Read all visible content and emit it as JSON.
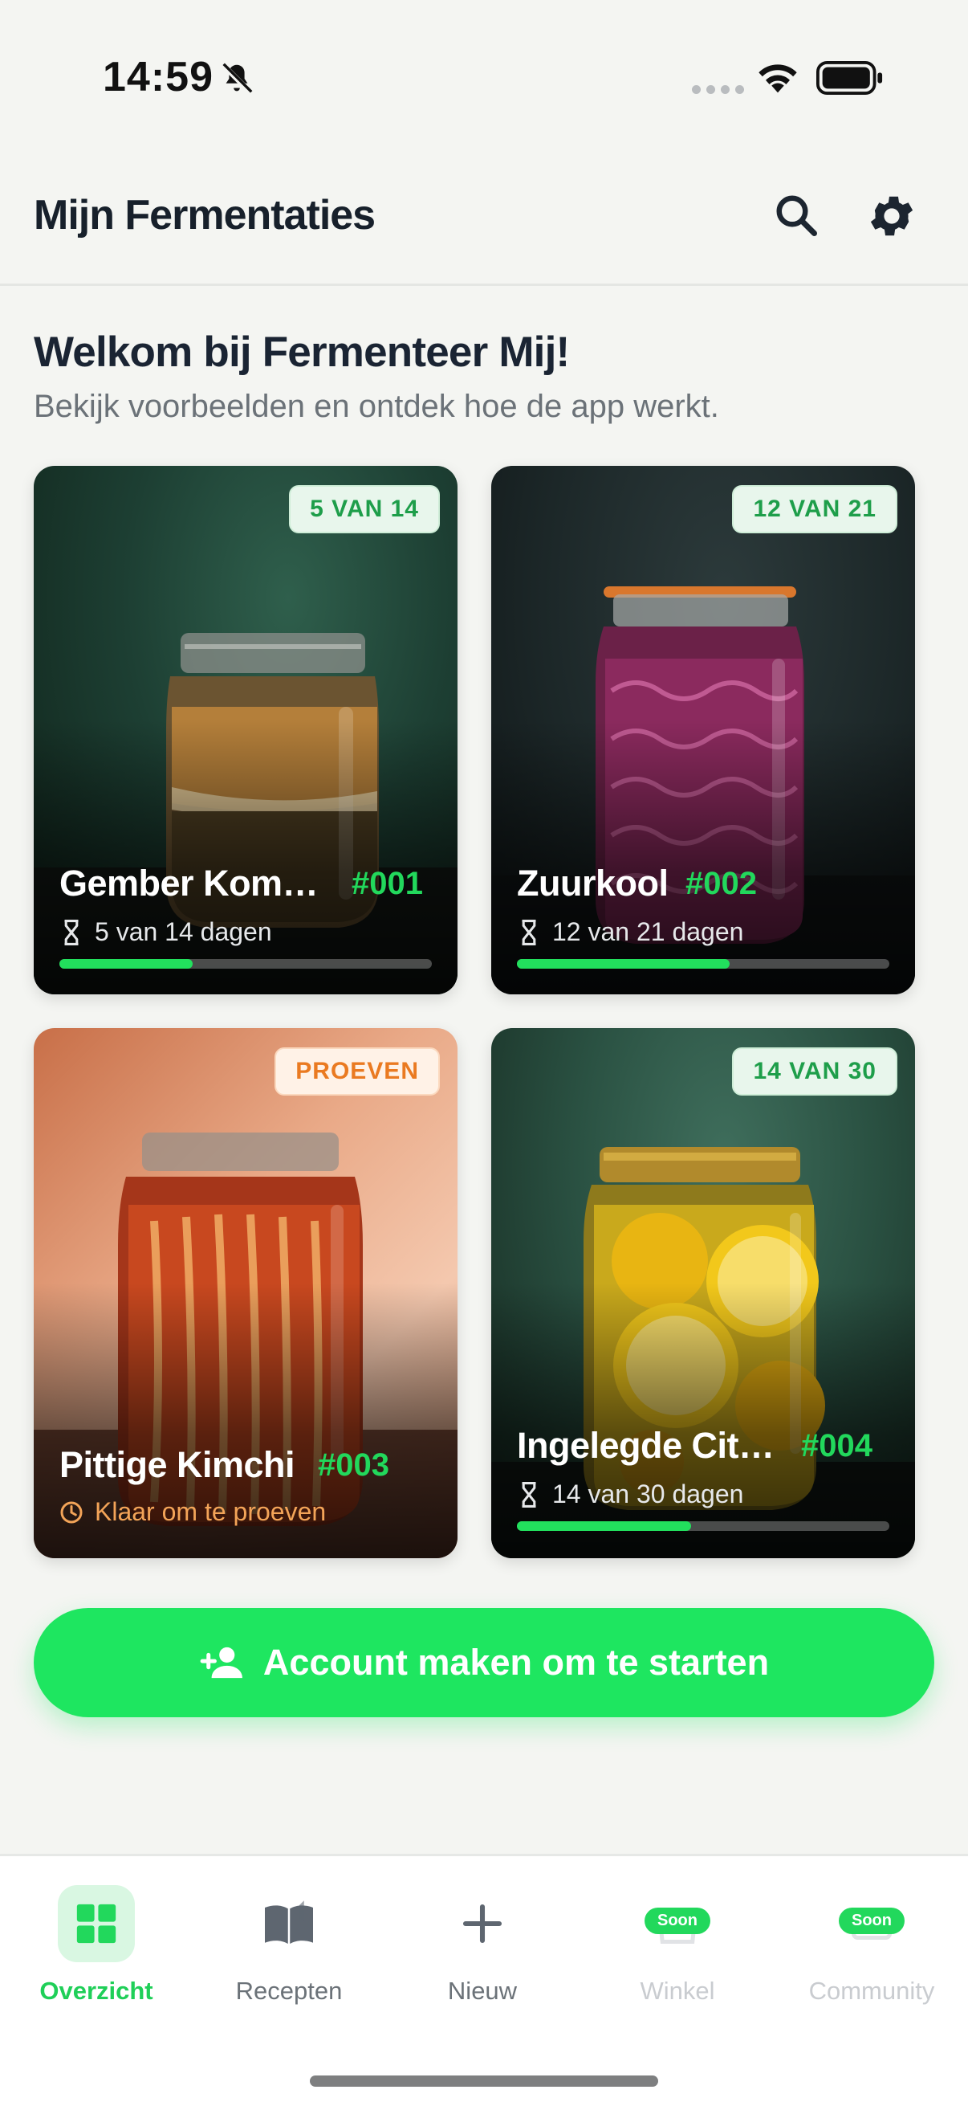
{
  "status_bar": {
    "time": "14:59"
  },
  "header": {
    "title": "Mijn Fermentaties",
    "search_icon": "search-icon",
    "settings_icon": "gear-icon"
  },
  "welcome": {
    "title": "Welkom bij Fermenteer Mij!",
    "subtitle": "Bekijk voorbeelden en ontdek hoe de app werkt."
  },
  "cards": [
    {
      "name": "Gember Kom…",
      "number": "#001",
      "badge": "5 VAN 14",
      "meta": "5 van 14 dagen",
      "progress": 0.357,
      "status": "in-progress"
    },
    {
      "name": "Zuurkool",
      "number": "#002",
      "badge": "12 VAN 21",
      "meta": "12 van 21 dagen",
      "progress": 0.571,
      "status": "in-progress"
    },
    {
      "name": "Pittige Kimchi",
      "number": "#003",
      "badge": "PROEVEN",
      "meta": "Klaar om te proeven",
      "status": "ready"
    },
    {
      "name": "Ingelegde Cit…",
      "number": "#004",
      "badge": "14 VAN 30",
      "meta": "14 van 30 dagen",
      "progress": 0.467,
      "status": "in-progress"
    }
  ],
  "cta": {
    "label": "Account maken om te starten",
    "icon": "add-person-icon"
  },
  "tabs": [
    {
      "label": "Overzicht",
      "icon": "grid-icon",
      "active": true
    },
    {
      "label": "Recepten",
      "icon": "book-icon"
    },
    {
      "label": "Nieuw",
      "icon": "plus-icon"
    },
    {
      "label": "Winkel",
      "icon": "shop-icon",
      "pill": "Soon"
    },
    {
      "label": "Community",
      "icon": "community-icon",
      "pill": "Soon"
    }
  ],
  "colors": {
    "accent": "#1ee660",
    "accent_text": "#22d85c",
    "taste_orange": "#ea7a21",
    "background": "#f4f5f2"
  }
}
